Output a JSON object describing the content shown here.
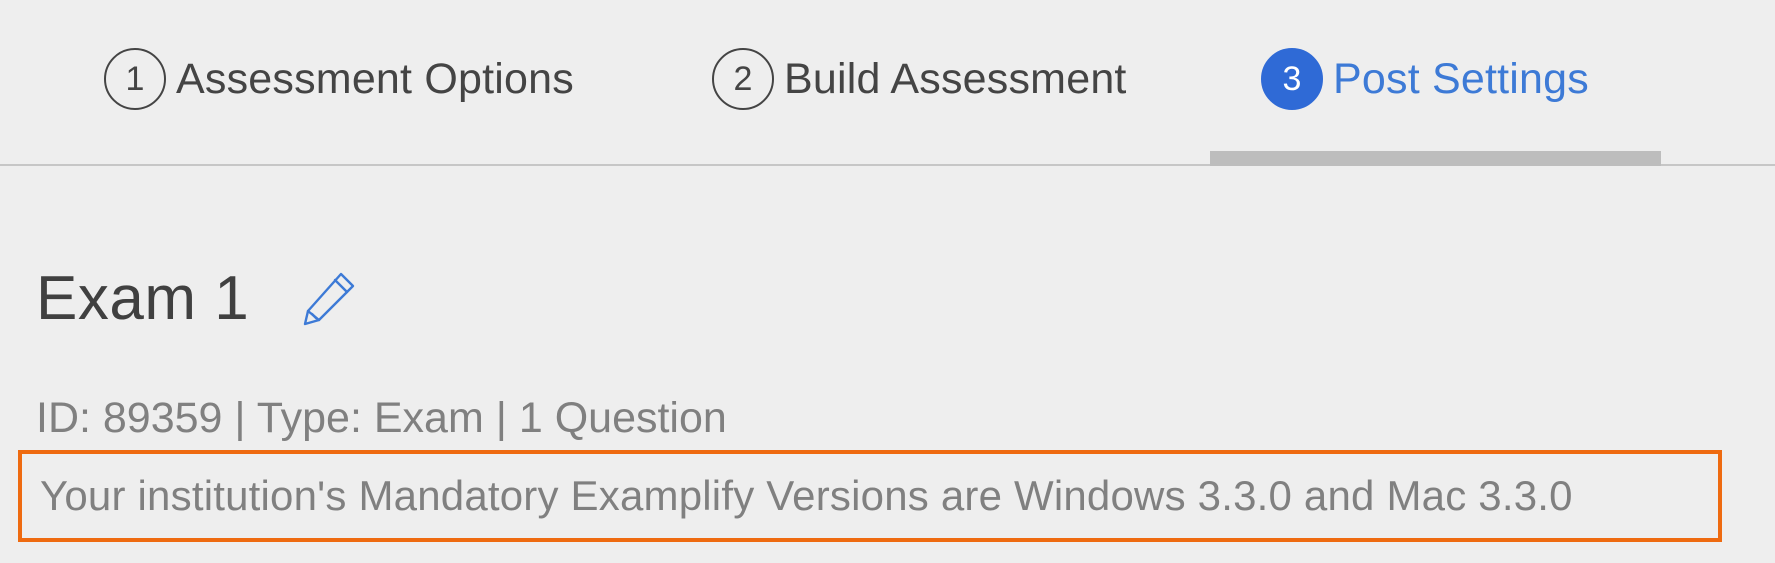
{
  "stepper": {
    "steps": [
      {
        "number": "1",
        "label": "Assessment Options",
        "active": false
      },
      {
        "number": "2",
        "label": "Build Assessment",
        "active": false
      },
      {
        "number": "3",
        "label": "Post Settings",
        "active": true
      }
    ]
  },
  "assessment": {
    "title": "Exam 1",
    "edit_icon": "pencil-icon",
    "meta": "ID: 89359 | Type: Exam | 1 Question",
    "notice": "Your institution's Mandatory Examplify Versions are Windows 3.3.0 and Mac 3.3.0"
  },
  "colors": {
    "active_step": "#2f6ad6",
    "active_label": "#3d7ad6",
    "highlight_border": "#ee6a10",
    "text_primary": "#404040",
    "text_muted": "#808080"
  }
}
